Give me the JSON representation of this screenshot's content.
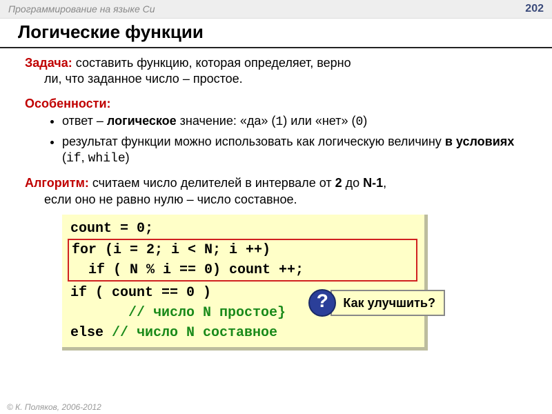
{
  "header": {
    "course": "Программирование на языке Си",
    "page": "202"
  },
  "title": "Логические функции",
  "task": {
    "label": "Задача:",
    "text1": " составить функцию, которая определяет, верно",
    "text2": "ли, что заданное число – простое."
  },
  "features": {
    "label": "Особенности:",
    "item1a": "ответ – ",
    "item1b": "логическое",
    "item1c": " значение: «да» (",
    "item1d": "1",
    "item1e": ") или «нет» (",
    "item1f": "0",
    "item1g": ")",
    "item2a": "результат функции можно использовать как логическую величину ",
    "item2b": "в условиях",
    "item2c": " (",
    "item2d": "if",
    "item2e": ",  ",
    "item2f": "while",
    "item2g": ")"
  },
  "algo": {
    "label": "Алгоритм:",
    "text1": " считаем число делителей в интервале от ",
    "two": "2",
    "text2": " до ",
    "n1": "N-1",
    "text3": ",",
    "text4": "если оно не равно нулю – число составное."
  },
  "code": {
    "l1": "count = 0;",
    "l2": "for (i = 2; i < N; i ++)",
    "l3": "  if ( N % i == 0) count ++;",
    "l4": "if ( count == 0 )",
    "l5": "       // число N простое}",
    "l6a": "else ",
    "l6b": "// число N составное"
  },
  "callout": {
    "q": "?",
    "text": "Как улучшить?"
  },
  "footer": "© К. Поляков, 2006-2012"
}
